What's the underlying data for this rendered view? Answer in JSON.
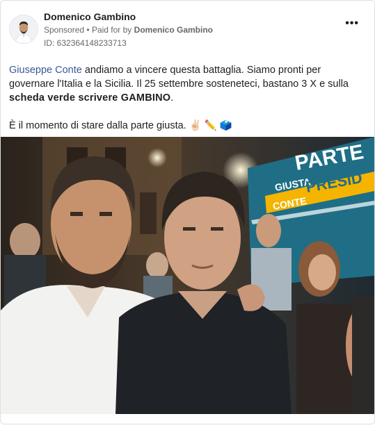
{
  "advertiser": {
    "name": "Domenico Gambino",
    "sponsored_label": "Sponsored",
    "separator": "•",
    "paid_for_prefix": "Paid for by",
    "paid_for_name": "Domenico Gambino",
    "ad_id": "ID: 632364148233713"
  },
  "menu": {
    "icon": "more-horizontal-icon",
    "label": "•••"
  },
  "post": {
    "mention": "Giuseppe Conte",
    "text_1": " andiamo a vincere questa battaglia. Siamo pronti per governare l'Italia e la Sicilia. Il 25 settembre sosteneteci, bastano 3 X e sulla ",
    "bold_text": "scheda verde scrivere GAMBINO",
    "text_2": ".",
    "line_2": "È il momento di stare dalla parte giusta. ✌🏻 ✏️ 🗳️"
  },
  "photo": {
    "banner_text_1": "PARTE",
    "banner_text_2": "GIUSTA",
    "banner_text_3": "PRESID",
    "banner_text_4": "CONTE"
  },
  "colors": {
    "link": "#385898",
    "banner": "#1f6e86",
    "banner_stripe": "#f4b400"
  }
}
